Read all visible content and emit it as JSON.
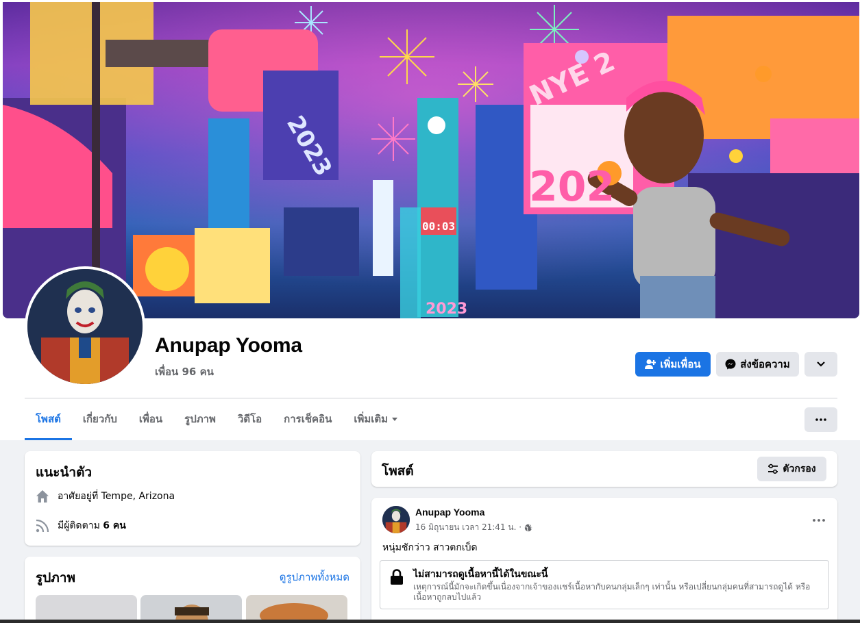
{
  "profile": {
    "name": "Anupap Yooma",
    "friends": "เพื่อน 96 คน"
  },
  "actions": {
    "add_friend": "เพิ่มเพื่อน",
    "message": "ส่งข้อความ"
  },
  "tabs": [
    {
      "label": "โพสต์"
    },
    {
      "label": "เกี่ยวกับ"
    },
    {
      "label": "เพื่อน"
    },
    {
      "label": "รูปภาพ"
    },
    {
      "label": "วิดีโอ"
    },
    {
      "label": "การเช็คอิน"
    },
    {
      "label": "เพิ่มเติม"
    }
  ],
  "intro": {
    "title": "แนะนำตัว",
    "lives_in": "อาศัยอยู่ที่ Tempe, Arizona",
    "followers_prefix": "มีผู้ติดตาม ",
    "followers_count": "6 คน"
  },
  "photos": {
    "title": "รูปภาพ",
    "see_all": "ดูรูปภาพทั้งหมด"
  },
  "posts": {
    "title": "โพสต์",
    "filter": "ตัวกรอง"
  },
  "post": {
    "author": "Anupap Yooma",
    "date": "16 มิถุนายน เวลา 21:41 น. ·",
    "text": "หนุ่มชักว่าว สาวตกเบ็ด",
    "unavailable_title": "ไม่สามารถดูเนื้อหานี้ได้ในขณะนี้",
    "unavailable_body": "เหตุการณ์นี้มักจะเกิดขึ้นเนื่องจากเจ้าของแชร์เนื้อหากับคนกลุ่มเล็กๆ เท่านั้น หรือเปลี่ยนกลุ่มคนที่สามารถดูได้ หรือเนื้อหาถูกลบไปแล้ว"
  },
  "cover_signs": {
    "year_a": "2023",
    "year_b": "2023",
    "year_c": "202",
    "nye": "NYE 2",
    "clock": "00:03"
  },
  "icons": [
    "person-add-icon",
    "messenger-icon",
    "chevron-down-icon",
    "more-icon",
    "home-icon",
    "rss-icon",
    "filter-icon",
    "globe-icon",
    "lock-icon"
  ],
  "colors": {
    "accent": "#1b74e4",
    "page_bg": "#f0f2f5",
    "secondary_text": "#65676b"
  }
}
